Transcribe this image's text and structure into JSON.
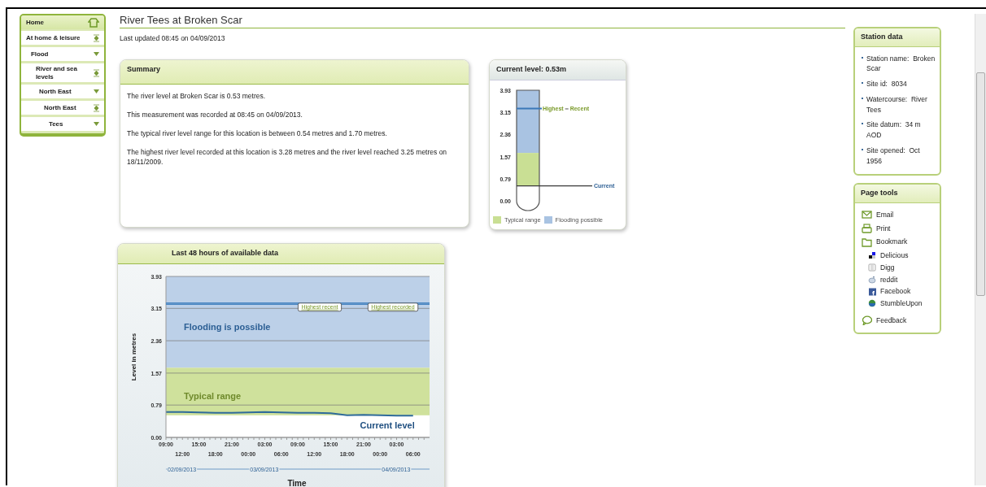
{
  "nav": {
    "items": [
      {
        "label": "Home",
        "kind": "home"
      },
      {
        "label": "At home & leisure",
        "kind": "expand",
        "children": [
          {
            "label": "Flood",
            "kind": "menu",
            "children": [
              {
                "label": "River and sea levels",
                "kind": "expand",
                "children": [
                  {
                    "label": "North East",
                    "kind": "menu",
                    "children": [
                      {
                        "label": "North East",
                        "kind": "expand",
                        "children": [
                          {
                            "label": "Tees",
                            "kind": "menu"
                          }
                        ]
                      }
                    ]
                  }
                ]
              }
            ]
          }
        ]
      }
    ]
  },
  "page": {
    "title": "River Tees at Broken Scar",
    "updated": "Last updated 08:45 on 04/09/2013"
  },
  "summary": {
    "title": "Summary",
    "paragraphs": [
      "The river level at Broken Scar is 0.53 metres.",
      "This measurement was recorded at 08:45 on 04/09/2013.",
      "The typical river level range for this location is between 0.54 metres and 1.70 metres.",
      "The highest river level recorded at this location is 3.28 metres and the river level reached 3.25 metres on 18/11/2009."
    ]
  },
  "gauge": {
    "title": "Current level: 0.53m",
    "ticks": [
      "3.93",
      "3.15",
      "2.36",
      "1.57",
      "0.79",
      "0.00"
    ],
    "markers": [
      "Highest",
      "Recent"
    ],
    "current": "Current",
    "legend": [
      {
        "label": "Typical range",
        "color": "#c9df94"
      },
      {
        "label": "Flooding possible",
        "color": "#a9c3e2"
      }
    ]
  },
  "history": {
    "title": "Last 48 hours of available data",
    "chart_data": {
      "type": "line",
      "xlabel": "Time",
      "ylabel": "Level in metres",
      "ylim": [
        0,
        3.93
      ],
      "categories": [
        "09:00",
        "12:00",
        "15:00",
        "18:00",
        "21:00",
        "00:00",
        "03:00",
        "06:00",
        "09:00",
        "12:00",
        "15:00",
        "18:00",
        "21:00",
        "00:00",
        "03:00",
        "06:00"
      ],
      "series": [
        {
          "name": "Current level",
          "color": "#2f6b9a",
          "values": [
            0.62,
            0.62,
            0.61,
            0.6,
            0.6,
            0.61,
            0.62,
            0.61,
            0.6,
            0.6,
            0.59,
            0.54,
            0.55,
            0.54,
            0.53,
            0.53
          ]
        }
      ],
      "yticks": [
        {
          "value": 0,
          "label": "0.00"
        },
        {
          "value": 0.79,
          "label": "0.79"
        },
        {
          "value": 1.57,
          "label": "1.57"
        },
        {
          "value": 2.36,
          "label": "2.36"
        },
        {
          "value": 3.15,
          "label": "3.15"
        },
        {
          "value": 3.93,
          "label": "3.93"
        }
      ],
      "grid": true,
      "bands": [
        {
          "axis": "y",
          "from": 1.7,
          "to": 3.93,
          "label": "Flooding is possible",
          "color": "#bcd0e8"
        },
        {
          "axis": "y",
          "from": 0.54,
          "to": 1.7,
          "label": "Typical range",
          "color": "#cfe19c"
        }
      ],
      "ref_lines": [
        {
          "axis": "y",
          "value": 3.25,
          "label": "Highest recent"
        },
        {
          "axis": "y",
          "value": 3.28,
          "label": "Highest recorded"
        }
      ],
      "annotations": [
        {
          "text": "02/09/2013"
        },
        {
          "text": "03/09/2013"
        },
        {
          "text": "04/09/2013"
        }
      ]
    }
  },
  "station": {
    "title": "Station data",
    "items": [
      {
        "label": "Station name:",
        "value": "Broken Scar"
      },
      {
        "label": "Site id:",
        "value": "8034"
      },
      {
        "label": "Watercourse:",
        "value": "River Tees"
      },
      {
        "label": "Site datum:",
        "value": "34 m AOD"
      },
      {
        "label": "Site opened:",
        "value": "Oct 1956"
      }
    ]
  },
  "tools": {
    "title": "Page tools",
    "items": [
      {
        "label": "Email",
        "kind": "email"
      },
      {
        "label": "Print",
        "kind": "print"
      },
      {
        "label": "Bookmark",
        "kind": "bookmark",
        "children": [
          {
            "label": "Delicious",
            "kind": "squares"
          },
          {
            "label": "Digg",
            "kind": "grey"
          },
          {
            "label": "reddit",
            "kind": "robot"
          },
          {
            "label": "Facebook",
            "kind": "square"
          },
          {
            "label": "StumbleUpon",
            "kind": "globe"
          }
        ]
      },
      {
        "label": "Feedback",
        "kind": "feedback"
      }
    ]
  }
}
